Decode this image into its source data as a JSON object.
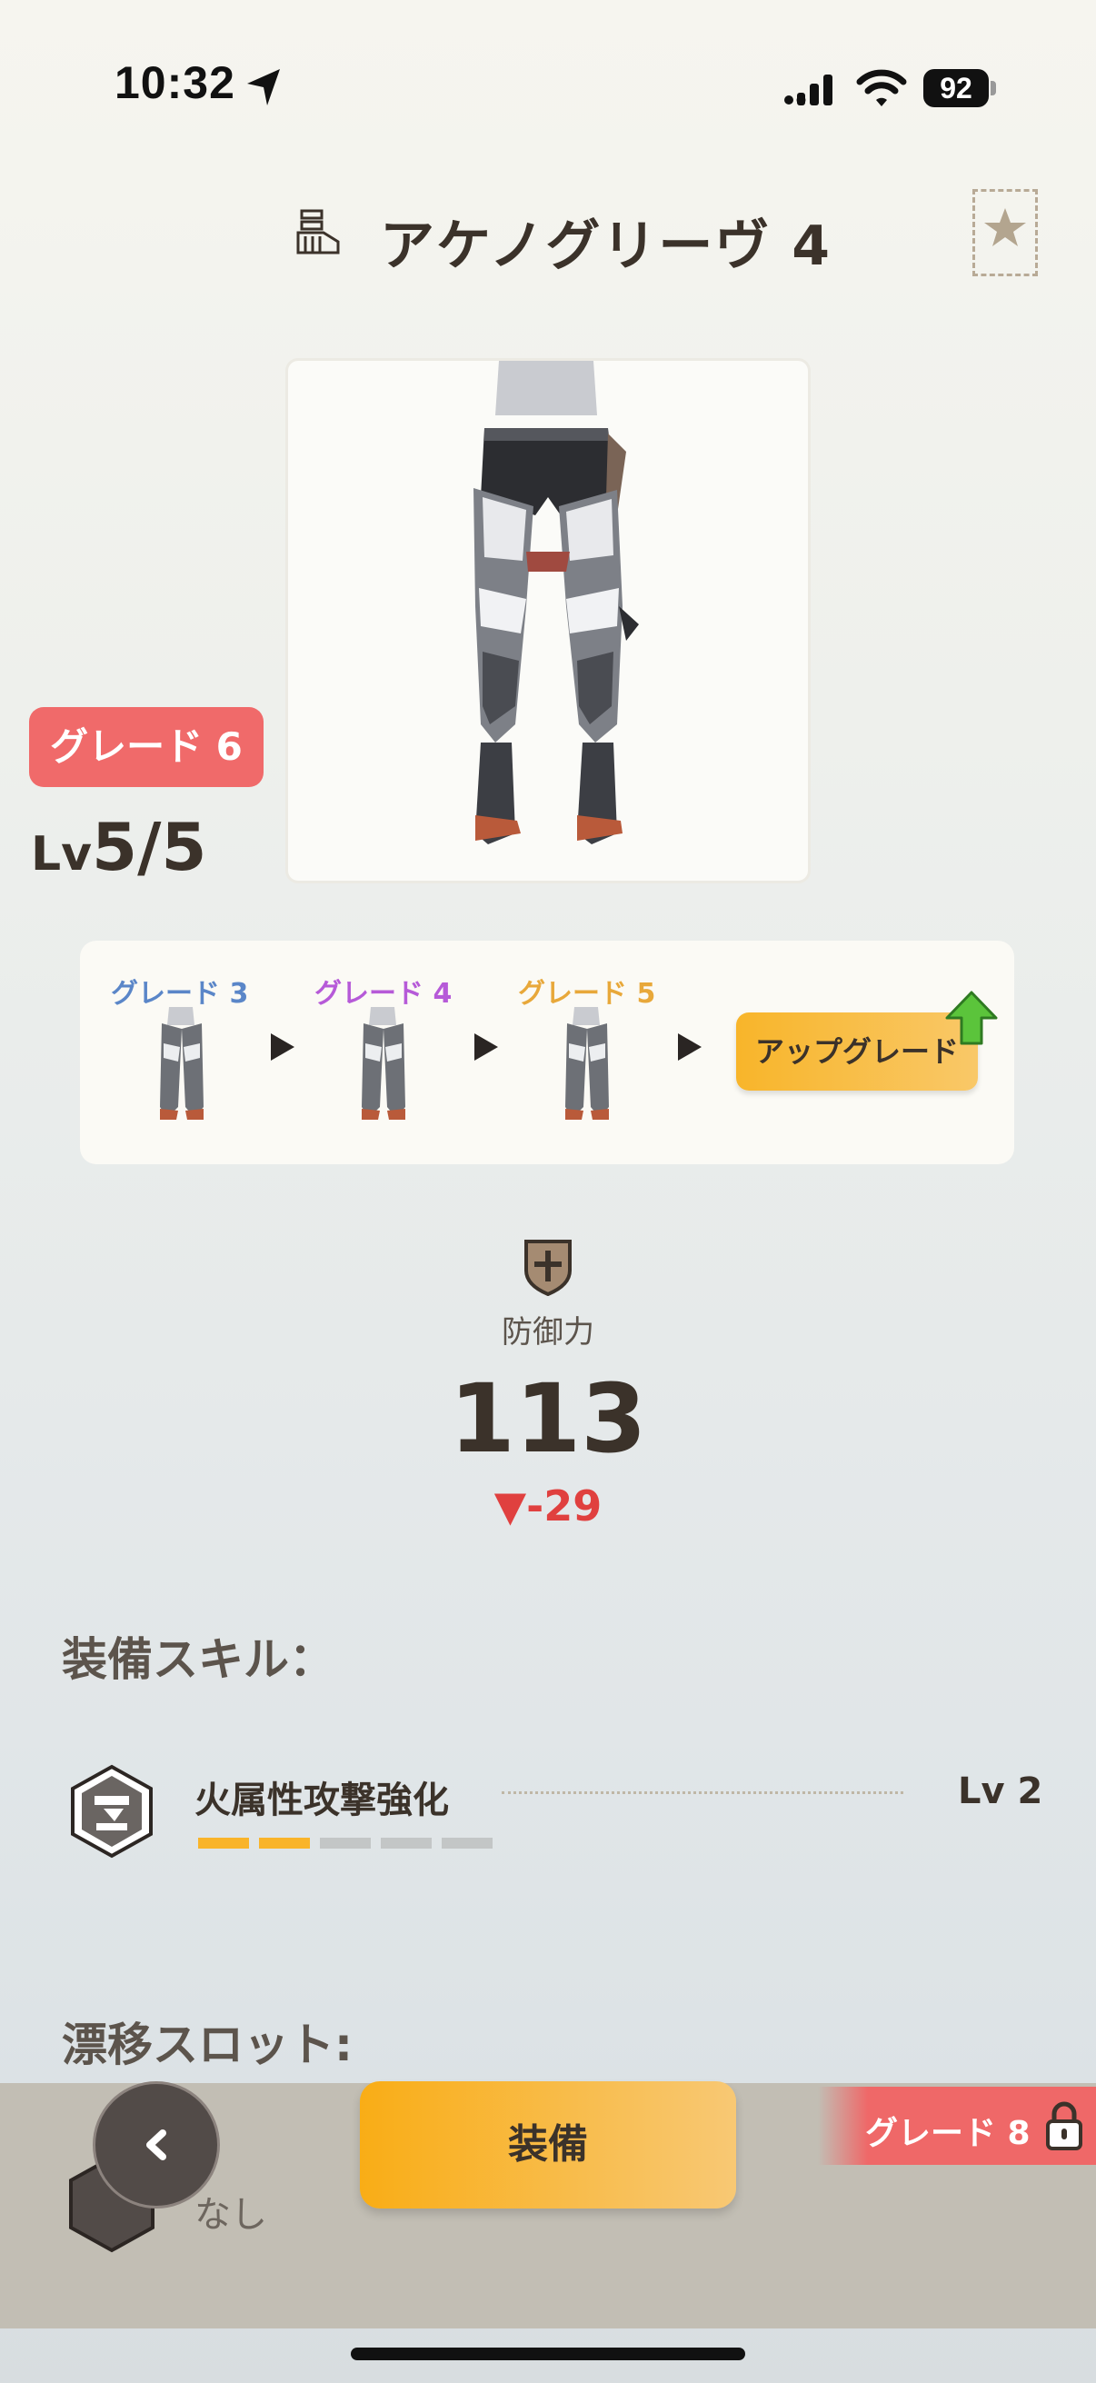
{
  "status_bar": {
    "time": "10:32",
    "battery": "92"
  },
  "header": {
    "icon": "armor-legs-icon",
    "title": "アケノグリーヴ 4",
    "favorite_icon": "star-icon"
  },
  "item": {
    "grade_badge": "グレード 6",
    "level_prefix": "Lv",
    "level_value": "5/5"
  },
  "upgrade_path": {
    "stages": [
      {
        "label": "グレード 3",
        "color": "#5a86c8"
      },
      {
        "label": "グレード 4",
        "color": "#b65ad8"
      },
      {
        "label": "グレード 5",
        "color": "#e8a83a"
      }
    ],
    "button_label": "アップグレード",
    "button_icon": "up-arrow-icon"
  },
  "stat": {
    "icon": "shield-icon",
    "label": "防御力",
    "value": "113",
    "delta": "▼-29"
  },
  "skills": {
    "title": "装備スキル：",
    "items": [
      {
        "name": "火属性攻撃強化",
        "level": "Lv 2",
        "filled": 2,
        "total": 5
      }
    ]
  },
  "drift_slot": {
    "title": "漂移スロット:",
    "value": "なし"
  },
  "bottom": {
    "equip_label": "装備",
    "back_icon": "chevron-left-icon",
    "lock_label": "グレード 8",
    "lock_icon": "lock-icon"
  },
  "colors": {
    "accent": "#f9b42a",
    "grade_badge": "#f06a6a",
    "negative": "#e0403f",
    "text": "#3b322a"
  }
}
